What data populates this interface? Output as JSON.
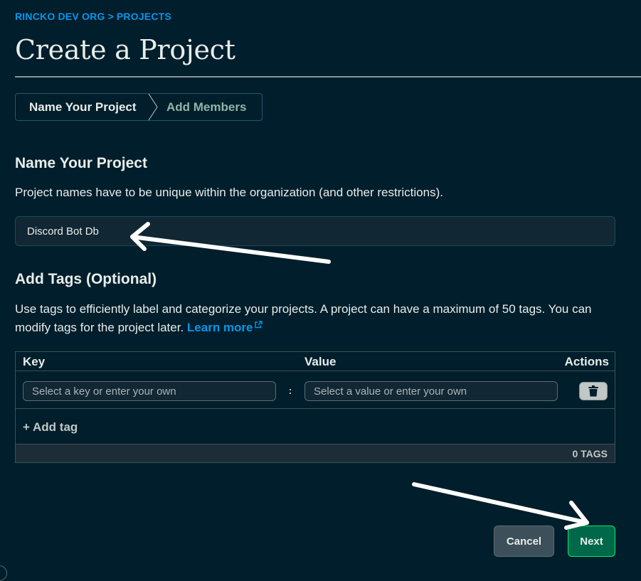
{
  "breadcrumb": {
    "org": "RINCKO DEV ORG",
    "separator": ">",
    "section": "PROJECTS"
  },
  "page": {
    "title": "Create a Project"
  },
  "stepper": {
    "steps": [
      "Name Your Project",
      "Add Members"
    ],
    "active_index": 0
  },
  "name_section": {
    "heading": "Name Your Project",
    "description": "Project names have to be unique within the organization (and other restrictions).",
    "input_value": "Discord Bot Db"
  },
  "tags_section": {
    "heading": "Add Tags (Optional)",
    "description": "Use tags to efficiently label and categorize your projects. A project can have a maximum of 50 tags. You can modify tags for the project later.",
    "learn_more": "Learn more",
    "columns": {
      "key": "Key",
      "value": "Value",
      "actions": "Actions"
    },
    "row": {
      "key_placeholder": "Select a key or enter your own",
      "separator": ":",
      "value_placeholder": "Select a value or enter your own",
      "delete_icon": "trash-icon"
    },
    "add_tag": "+ Add tag",
    "count_label": "0 TAGS"
  },
  "footer": {
    "cancel": "Cancel",
    "next": "Next"
  },
  "colors": {
    "background": "#001e2b",
    "link": "#0498ec",
    "primary_button": "#00684a",
    "primary_border": "#00ed64"
  }
}
